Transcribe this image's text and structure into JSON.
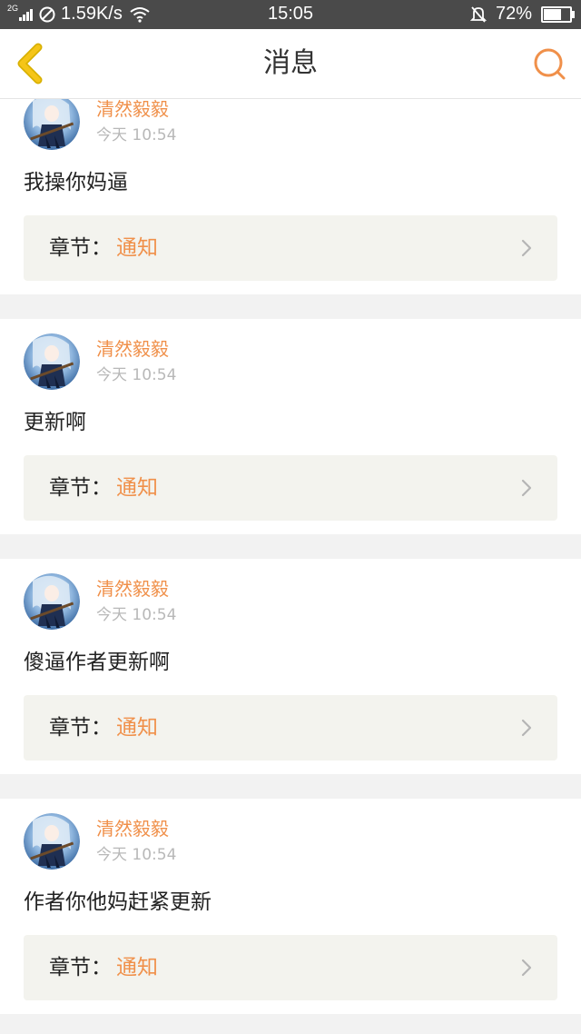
{
  "status_bar": {
    "network": "2G",
    "speed": "1.59K/s",
    "time": "15:05",
    "battery": "72%",
    "battery_level": 0.72
  },
  "header": {
    "title": "消息",
    "back_icon": "chevron-left-icon",
    "search_icon": "search-icon",
    "accent_color": "#f0904a",
    "back_color": "#f5c518"
  },
  "messages": [
    {
      "user": "清然毅毅",
      "time": "今天 10:54",
      "text": "我操你妈逼",
      "chapter_label": "章节：",
      "chapter_value": "通知"
    },
    {
      "user": "清然毅毅",
      "time": "今天 10:54",
      "text": "更新啊",
      "chapter_label": "章节：",
      "chapter_value": "通知"
    },
    {
      "user": "清然毅毅",
      "time": "今天 10:54",
      "text": "傻逼作者更新啊",
      "chapter_label": "章节：",
      "chapter_value": "通知"
    },
    {
      "user": "清然毅毅",
      "time": "今天 10:54",
      "text": "作者你他妈赶紧更新",
      "chapter_label": "章节：",
      "chapter_value": "通知"
    }
  ]
}
